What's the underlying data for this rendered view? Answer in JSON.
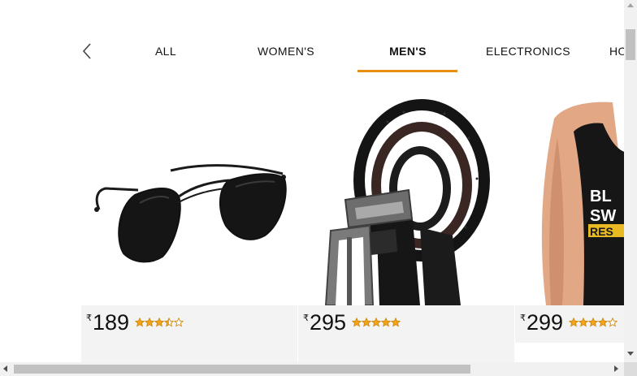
{
  "tabs": {
    "items": [
      {
        "label": "ALL"
      },
      {
        "label": "WOMEN'S"
      },
      {
        "label": "MEN'S"
      },
      {
        "label": "ELECTRONICS"
      },
      {
        "label": "HO"
      }
    ],
    "active_index": 2,
    "active_color": "#e88f12"
  },
  "products": [
    {
      "name_icon": "aviator-sunglasses-image",
      "currency": "₹",
      "price": "189",
      "rating": 3.5,
      "rating_max": 5
    },
    {
      "name_icon": "leather-belt-image",
      "currency": "₹",
      "price": "295",
      "rating": 5,
      "rating_max": 5
    },
    {
      "name_icon": "mens-tank-top-image",
      "currency": "₹",
      "price": "299",
      "rating": 4,
      "rating_max": 5
    }
  ],
  "tank_top_print": {
    "line1": "BL",
    "line2": "SW",
    "line3": "RES"
  },
  "colors": {
    "star": "#f4a418",
    "price_bar": "#f3f3f3"
  }
}
